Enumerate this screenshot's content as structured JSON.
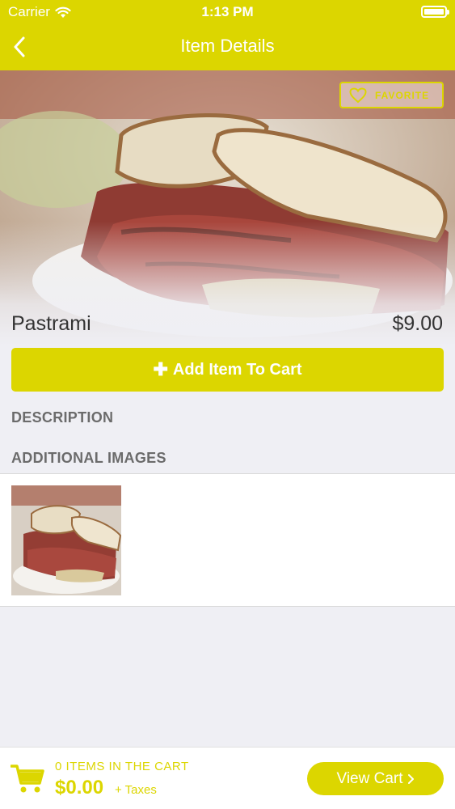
{
  "status_bar": {
    "carrier": "Carrier",
    "time": "1:13 PM"
  },
  "nav": {
    "title": "Item Details"
  },
  "favorite": {
    "label": "FAVORITE"
  },
  "item": {
    "name": "Pastrami",
    "price": "$9.00"
  },
  "add_to_cart": {
    "label": "Add Item To Cart"
  },
  "sections": {
    "description": "DESCRIPTION",
    "additional_images": "ADDITIONAL IMAGES"
  },
  "cart": {
    "count_text": "0 ITEMS IN THE CART",
    "total": "$0.00",
    "taxes": "+ Taxes",
    "view_label": "View Cart"
  },
  "icons": [
    "wifi-icon",
    "battery-icon",
    "back-chevron-icon",
    "heart-icon",
    "plus-icon",
    "cart-icon",
    "chevron-right-icon"
  ],
  "colors": {
    "accent": "#dcd600",
    "background": "#efeff4",
    "text": "#333333",
    "section_text": "#6b6b6b"
  }
}
